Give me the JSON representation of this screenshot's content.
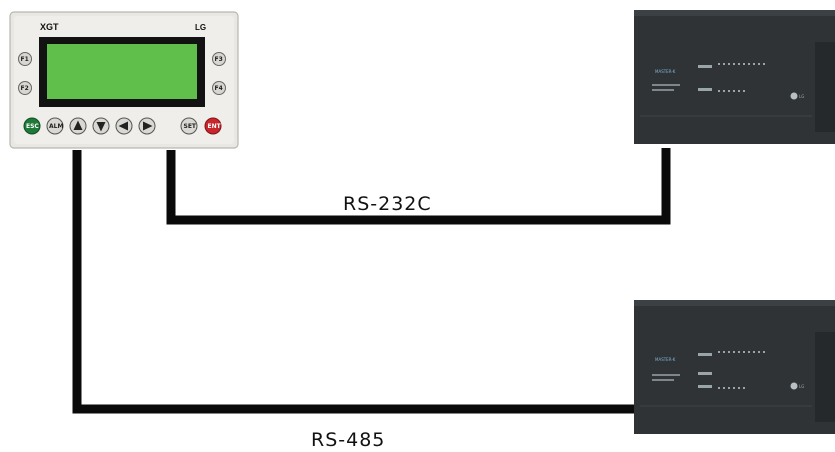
{
  "hmi": {
    "brand_left": "XGT",
    "brand_right": "LG",
    "function_keys": [
      "F1",
      "F2",
      "F3",
      "F4"
    ],
    "bottom_keys": [
      "ESC",
      "ALM",
      "SET",
      "ENT"
    ],
    "screen_color": "#5fbf4a"
  },
  "links": {
    "rs232_label": "RS-232C",
    "rs485_label": "RS-485"
  },
  "plc": {
    "body_color": "#2f3336",
    "brand": "MASTER-K",
    "logo": "LG"
  }
}
